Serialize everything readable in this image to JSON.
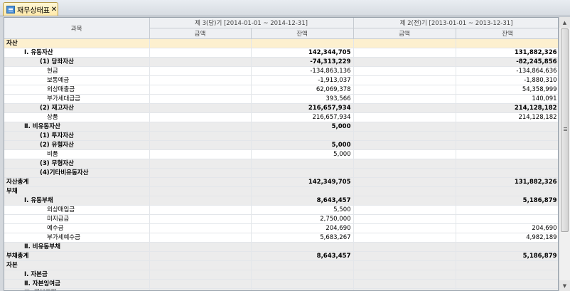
{
  "tab": {
    "title": "재무상태표",
    "close": "✕"
  },
  "header": {
    "subject": "과목",
    "period_current": "제 3(당)기 [2014-01-01 ~ 2014-12-31]",
    "period_prior": "제 2(전)기 [2013-01-01 ~ 2013-12-31]",
    "amount": "금액",
    "balance": "잔액"
  },
  "rows": [
    {
      "label": "자산",
      "indent": 0,
      "bold": true,
      "style": "sel",
      "c1": "",
      "c2": "",
      "c3": "",
      "c4": ""
    },
    {
      "label": "Ⅰ. 유동자산",
      "indent": 1,
      "bold": true,
      "style": "",
      "c1": "",
      "c2": "142,344,705",
      "c3": "",
      "c4": "131,882,326"
    },
    {
      "label": "(1) 당좌자산",
      "indent": 2,
      "bold": true,
      "style": "gray",
      "c1": "",
      "c2": "-74,313,229",
      "c3": "",
      "c4": "-82,245,856"
    },
    {
      "label": "현금",
      "indent": 3,
      "bold": false,
      "style": "",
      "c1": "",
      "c2": "-134,863,136",
      "c3": "",
      "c4": "-134,864,636"
    },
    {
      "label": "보통예금",
      "indent": 3,
      "bold": false,
      "style": "",
      "c1": "",
      "c2": "-1,913,037",
      "c3": "",
      "c4": "-1,880,310"
    },
    {
      "label": "외상매출금",
      "indent": 3,
      "bold": false,
      "style": "",
      "c1": "",
      "c2": "62,069,378",
      "c3": "",
      "c4": "54,358,999"
    },
    {
      "label": "부가세대급금",
      "indent": 3,
      "bold": false,
      "style": "",
      "c1": "",
      "c2": "393,566",
      "c3": "",
      "c4": "140,091"
    },
    {
      "label": "(2) 재고자산",
      "indent": 2,
      "bold": true,
      "style": "gray",
      "c1": "",
      "c2": "216,657,934",
      "c3": "",
      "c4": "214,128,182"
    },
    {
      "label": "상품",
      "indent": 3,
      "bold": false,
      "style": "",
      "c1": "",
      "c2": "216,657,934",
      "c3": "",
      "c4": "214,128,182"
    },
    {
      "label": "Ⅱ. 비유동자산",
      "indent": 1,
      "bold": true,
      "style": "gray",
      "c1": "",
      "c2": "5,000",
      "c3": "",
      "c4": ""
    },
    {
      "label": "(1) 투자자산",
      "indent": 2,
      "bold": true,
      "style": "gray",
      "c1": "",
      "c2": "",
      "c3": "",
      "c4": ""
    },
    {
      "label": "(2) 유형자산",
      "indent": 2,
      "bold": true,
      "style": "gray",
      "c1": "",
      "c2": "5,000",
      "c3": "",
      "c4": ""
    },
    {
      "label": "비품",
      "indent": 3,
      "bold": false,
      "style": "",
      "c1": "",
      "c2": "5,000",
      "c3": "",
      "c4": ""
    },
    {
      "label": "(3) 무형자산",
      "indent": 2,
      "bold": true,
      "style": "gray",
      "c1": "",
      "c2": "",
      "c3": "",
      "c4": ""
    },
    {
      "label": "(4)기타비유동자산",
      "indent": 2,
      "bold": true,
      "style": "gray",
      "c1": "",
      "c2": "",
      "c3": "",
      "c4": ""
    },
    {
      "label": "자산총계",
      "indent": 0,
      "bold": true,
      "style": "gray",
      "c1": "",
      "c2": "142,349,705",
      "c3": "",
      "c4": "131,882,326"
    },
    {
      "label": "부채",
      "indent": 0,
      "bold": true,
      "style": "gray",
      "c1": "",
      "c2": "",
      "c3": "",
      "c4": ""
    },
    {
      "label": "Ⅰ. 유동부채",
      "indent": 1,
      "bold": true,
      "style": "gray",
      "c1": "",
      "c2": "8,643,457",
      "c3": "",
      "c4": "5,186,879"
    },
    {
      "label": "외상매입금",
      "indent": 3,
      "bold": false,
      "style": "",
      "c1": "",
      "c2": "5,500",
      "c3": "",
      "c4": ""
    },
    {
      "label": "미지급금",
      "indent": 3,
      "bold": false,
      "style": "",
      "c1": "",
      "c2": "2,750,000",
      "c3": "",
      "c4": ""
    },
    {
      "label": "예수금",
      "indent": 3,
      "bold": false,
      "style": "",
      "c1": "",
      "c2": "204,690",
      "c3": "",
      "c4": "204,690"
    },
    {
      "label": "부가세예수금",
      "indent": 3,
      "bold": false,
      "style": "",
      "c1": "",
      "c2": "5,683,267",
      "c3": "",
      "c4": "4,982,189"
    },
    {
      "label": "Ⅱ. 비유동부채",
      "indent": 1,
      "bold": true,
      "style": "gray",
      "c1": "",
      "c2": "",
      "c3": "",
      "c4": ""
    },
    {
      "label": "부채총계",
      "indent": 0,
      "bold": true,
      "style": "gray",
      "c1": "",
      "c2": "8,643,457",
      "c3": "",
      "c4": "5,186,879"
    },
    {
      "label": "자본",
      "indent": 0,
      "bold": true,
      "style": "gray",
      "c1": "",
      "c2": "",
      "c3": "",
      "c4": ""
    },
    {
      "label": "Ⅰ. 자본금",
      "indent": 1,
      "bold": true,
      "style": "gray",
      "c1": "",
      "c2": "",
      "c3": "",
      "c4": ""
    },
    {
      "label": "Ⅱ. 자본잉여금",
      "indent": 1,
      "bold": true,
      "style": "gray",
      "c1": "",
      "c2": "",
      "c3": "",
      "c4": ""
    },
    {
      "label": "Ⅲ. 자본조정",
      "indent": 1,
      "bold": true,
      "style": "gray",
      "c1": "",
      "c2": "",
      "c3": "",
      "c4": ""
    }
  ]
}
